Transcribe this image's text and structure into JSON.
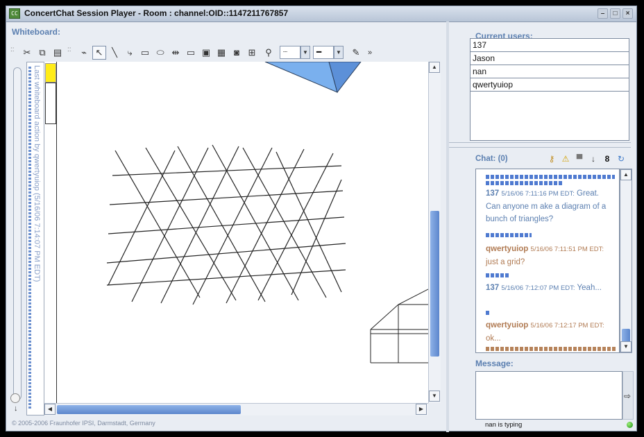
{
  "window": {
    "title": "ConcertChat Session Player - Room : channel:OID::1147211767857",
    "icon_text": "CC"
  },
  "whiteboard": {
    "label": "Whiteboard:",
    "history_text": "Last whiteboard action by qwertyuiop (5/16/06 7:14:07 PM EDT)",
    "footer": "© 2005-2006 Fraunhofer IPSI, Darmstadt, Germany",
    "tools": [
      {
        "name": "cut-icon",
        "glyph": "✂"
      },
      {
        "name": "copy-icon",
        "glyph": "⧉"
      },
      {
        "name": "paste-icon",
        "glyph": "▤"
      },
      {
        "name": "lasso-icon",
        "glyph": "⌁"
      },
      {
        "name": "pointer-icon",
        "glyph": "↖"
      },
      {
        "name": "line-icon",
        "glyph": "╲"
      },
      {
        "name": "connector-icon",
        "glyph": "⤷"
      },
      {
        "name": "rectangle-icon",
        "glyph": "▭"
      },
      {
        "name": "ellipse-icon",
        "glyph": "⬭"
      },
      {
        "name": "link-icon",
        "glyph": "⇹"
      },
      {
        "name": "text-box-icon",
        "glyph": "▭"
      },
      {
        "name": "note-icon",
        "glyph": "▣"
      },
      {
        "name": "image-icon",
        "glyph": "▦"
      },
      {
        "name": "camera-icon",
        "glyph": "◙"
      },
      {
        "name": "export-icon",
        "glyph": "⊞"
      },
      {
        "name": "eyedropper-icon",
        "glyph": "⚲"
      },
      {
        "name": "line-style-icon",
        "glyph": "┈"
      },
      {
        "name": "line-width-icon",
        "glyph": "━"
      },
      {
        "name": "color-icon",
        "glyph": "✎"
      },
      {
        "name": "more-tools-icon",
        "glyph": "»"
      }
    ]
  },
  "users": {
    "label": "Current users:",
    "list": [
      "137",
      "Jason",
      "nan",
      "qwertyuiop"
    ]
  },
  "chat": {
    "label": "Chat: (0)",
    "messages": [
      {
        "sender": "137",
        "time": "5/16/06 7:11:16 PM EDT:",
        "text": "Great. Can anyone m ake a diagram of a bunch of triangles?"
      },
      {
        "sender": "qwertyuiop",
        "time": "5/16/06 7:11:51 PM EDT:",
        "text": "just a grid?"
      },
      {
        "sender": "137",
        "time": "5/16/06 7:12:07 PM EDT:",
        "text": "Yeah..."
      },
      {
        "sender": "qwertyuiop",
        "time": "5/16/06 7:12:17 PM EDT:",
        "text": "ok..."
      }
    ]
  },
  "message": {
    "label": "Message:",
    "typing_status": "nan is typing",
    "value": ""
  },
  "colors": {
    "accent": "#5b7fb0",
    "peer": "#b07a52",
    "shape_fill": "#7ab0ee"
  }
}
